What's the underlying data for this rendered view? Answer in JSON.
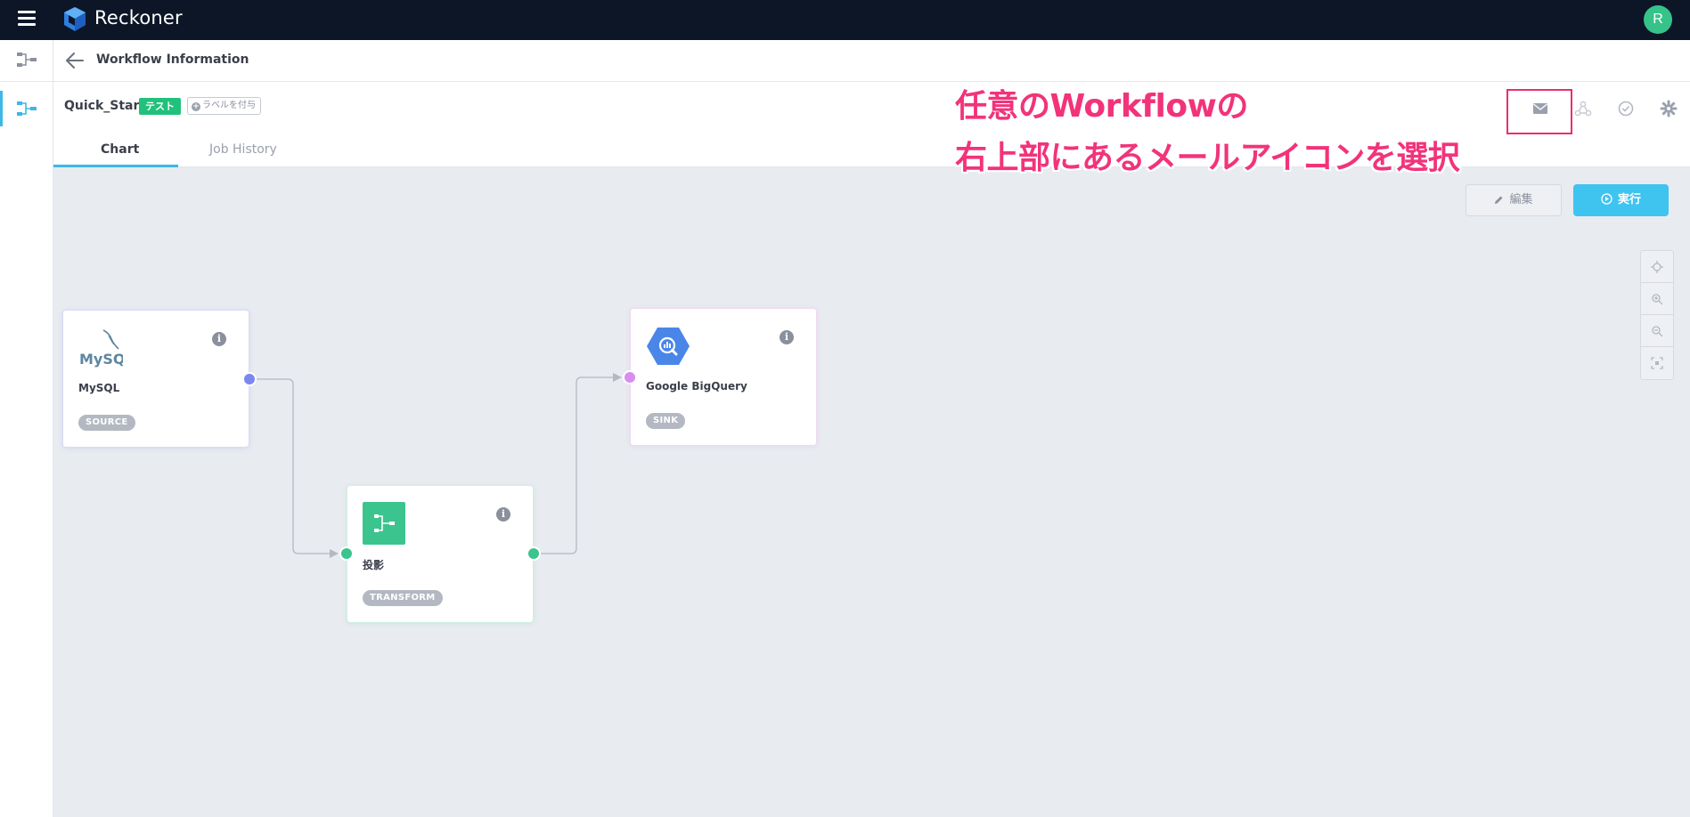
{
  "app": {
    "brand": "Reckoner",
    "user_initial": "R"
  },
  "header": {
    "title": "Workflow Information"
  },
  "workflow": {
    "name": "Quick_Start",
    "tag": "テスト",
    "add_label": "ラベルを付与"
  },
  "tabs": [
    {
      "label": "Chart",
      "active": true
    },
    {
      "label": "Job History",
      "active": false
    }
  ],
  "toolbar_icons": [
    "mail-icon",
    "share-nodes-icon",
    "clock-icon",
    "gear-icon"
  ],
  "annotation": {
    "line1": "任意のWorkflowの",
    "line2": "右上部にあるメールアイコンを選択"
  },
  "actions": {
    "edit_label": "編集",
    "run_label": "実行"
  },
  "nodes": [
    {
      "id": "mysql",
      "label": "MySQL",
      "badge": "SOURCE",
      "logo_text": "MySQL"
    },
    {
      "id": "transform",
      "label": "投影",
      "badge": "TRANSFORM"
    },
    {
      "id": "bigquery",
      "label": "Google BigQuery",
      "badge": "SINK"
    }
  ],
  "colors": {
    "topbar": "#0c1627",
    "accent": "#3cb7e8",
    "tag_test": "#21c17c",
    "annotation": "#f2337a",
    "source_port": "#7b86f0",
    "transform": "#3cc48e",
    "sink_port": "#d78ef0"
  }
}
